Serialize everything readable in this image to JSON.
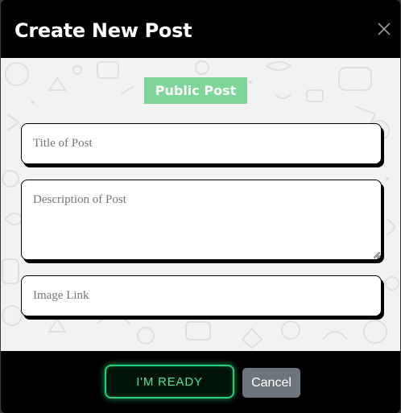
{
  "dialog": {
    "title": "Create New Post",
    "close_icon": "close-icon"
  },
  "body": {
    "visibility_badge": "Public Post",
    "title_placeholder": "Title of Post",
    "description_placeholder": "Description of Post",
    "image_placeholder": "Image Link"
  },
  "footer": {
    "ready_label": "I'M READY",
    "cancel_label": "Cancel"
  },
  "colors": {
    "badge_bg": "#7ed598",
    "ready_border": "#22d07a",
    "ready_text": "#4ce59a",
    "cancel_bg": "#6c757d"
  }
}
